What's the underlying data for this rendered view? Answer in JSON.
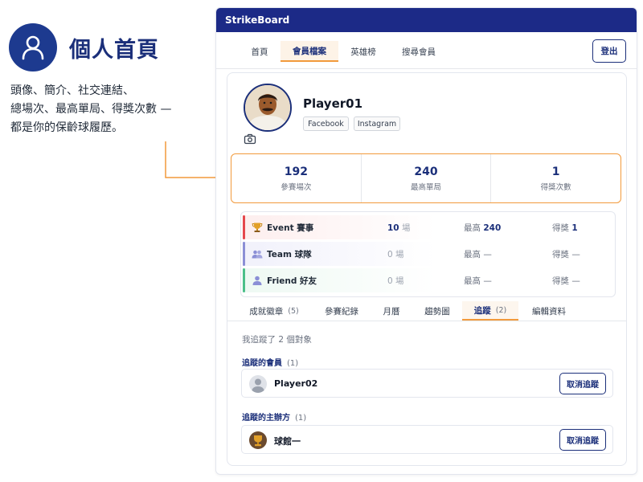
{
  "annotation": {
    "icon": "user-icon",
    "title": "個人首頁",
    "desc_lines": [
      "頭像、簡介、社交連結、",
      "總場次、最高單局、得獎次數 —",
      "都是你的保齡球履歷。"
    ]
  },
  "app": {
    "title": "StrikeBoard",
    "nav": [
      "首頁",
      "會員檔案",
      "英雄榜",
      "搜尋會員"
    ],
    "active_nav": "會員檔案",
    "logout_label": "登出"
  },
  "profile": {
    "name": "Player01",
    "socials": [
      "Facebook",
      "Instagram"
    ],
    "stats": [
      {
        "value": "192",
        "label": "參賽場次"
      },
      {
        "value": "240",
        "label": "最高單局"
      },
      {
        "value": "1",
        "label": "得獎次數"
      }
    ],
    "modes": [
      {
        "icon": "trophy-icon",
        "name": "Event 賽事",
        "count": "10",
        "count_unit": "場",
        "high_label": "最高",
        "high": "240",
        "award_label": "得獎",
        "award": "1",
        "accent": "#e5484d"
      },
      {
        "icon": "team-icon",
        "name": "Team 球隊",
        "count": "0",
        "count_unit": "場",
        "high_label": "最高",
        "high": "—",
        "award_label": "得獎",
        "award": "—",
        "accent": "#8b8fd6"
      },
      {
        "icon": "person-icon",
        "name": "Friend 好友",
        "count": "0",
        "count_unit": "場",
        "high_label": "最高",
        "high": "—",
        "award_label": "得獎",
        "award": "—",
        "accent": "#4cbf8a"
      }
    ]
  },
  "subtabs": [
    {
      "label": "成就徽章",
      "count": "(5)"
    },
    {
      "label": "參賽紀錄",
      "count": ""
    },
    {
      "label": "月曆",
      "count": ""
    },
    {
      "label": "趨勢圖",
      "count": ""
    },
    {
      "label": "追蹤",
      "count": "(2)"
    },
    {
      "label": "編輯資料",
      "count": ""
    }
  ],
  "active_subtab": "追蹤",
  "following": {
    "summary": "我追蹤了 2 個對象",
    "members_title": "追蹤的會員",
    "members_count": "(1)",
    "members": [
      {
        "name": "Player02",
        "button": "取消追蹤"
      }
    ],
    "hosts_title": "追蹤的主辦方",
    "hosts_count": "(1)",
    "hosts": [
      {
        "name": "球館一",
        "button": "取消追蹤"
      }
    ]
  },
  "colors": {
    "brand": "#1c2a87",
    "accent": "#f29a3c"
  }
}
